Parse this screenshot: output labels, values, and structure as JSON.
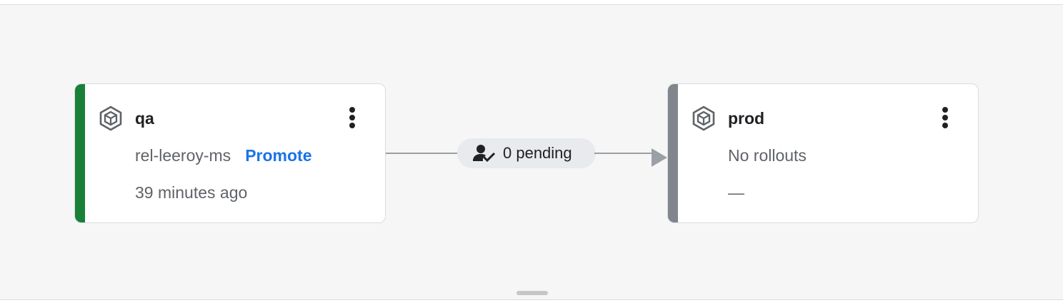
{
  "pipeline": {
    "stages": [
      {
        "name": "qa",
        "release": "rel-leeroy-ms",
        "action_label": "Promote",
        "time": "39 minutes ago",
        "status_color": "#188038",
        "icon": "deploy-target-icon"
      },
      {
        "name": "prod",
        "release": "No rollouts",
        "time": "—",
        "status_color": "#80868b",
        "icon": "deploy-target-icon"
      }
    ],
    "approval": {
      "label": "0 pending",
      "icon": "person-check-icon"
    }
  },
  "colors": {
    "accent": "#1a73e8",
    "success": "#188038",
    "neutral": "#80868b",
    "canvas_bg": "#f6f6f6"
  }
}
